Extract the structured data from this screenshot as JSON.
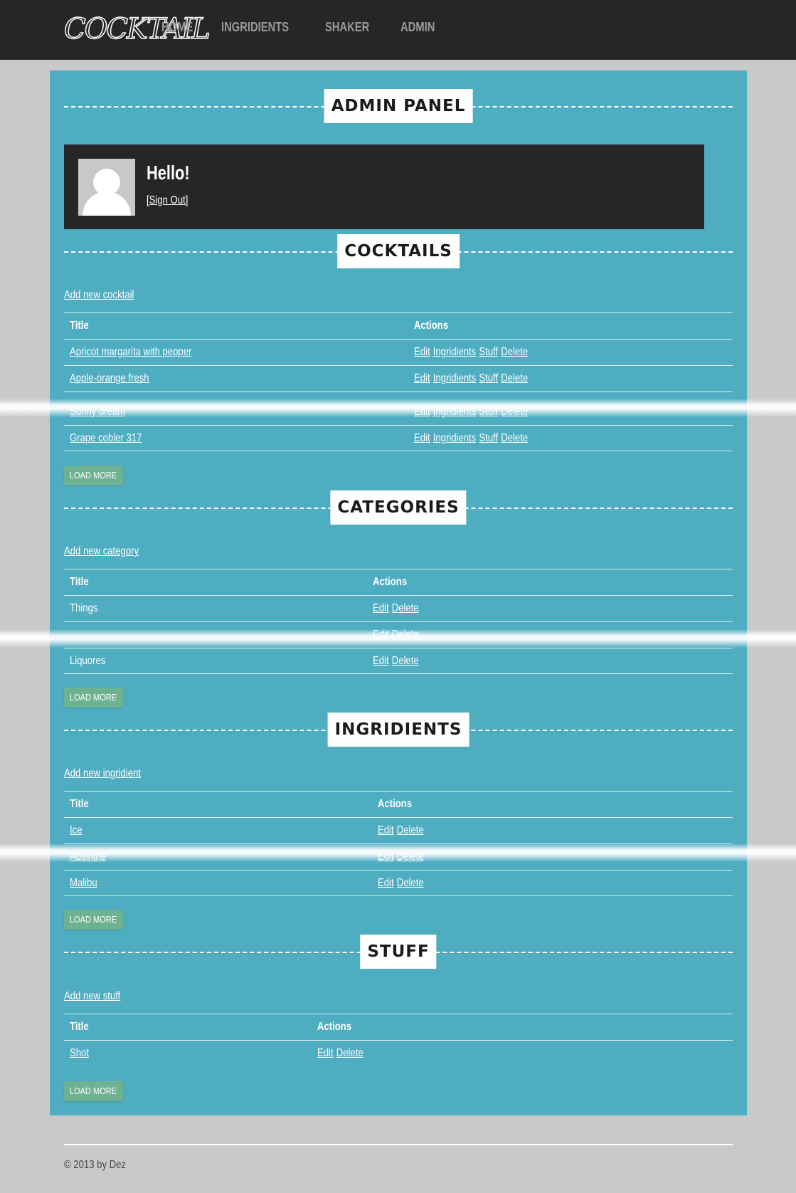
{
  "nav": {
    "brand": "COCKTAIL",
    "links": [
      "HOME",
      "INGRIDIENTS",
      "SHAKER",
      "ADMIN"
    ]
  },
  "admin": {
    "section_title": "ADMIN PANEL",
    "greeting": "Hello!",
    "sign_out": "[Sign Out]"
  },
  "cocktails": {
    "section_title": "COCKTAILS",
    "add_link": "Add new cocktail",
    "headers": {
      "title": "Title",
      "actions": "Actions"
    },
    "rows": [
      {
        "title": "Apricot margarita with pepper",
        "actions": [
          "Edit",
          "Ingridients",
          "Stuff",
          "Delete"
        ]
      },
      {
        "title": "Apple-orange fresh",
        "actions": [
          "Edit",
          "Ingridients",
          "Stuff",
          "Delete"
        ]
      },
      {
        "title": "Sunny dream",
        "actions": [
          "Edit",
          "Ingridients",
          "Stuff",
          "Delete"
        ]
      },
      {
        "title": "Grape cobler 317",
        "actions": [
          "Edit",
          "Ingridients",
          "Stuff",
          "Delete"
        ]
      }
    ],
    "load_more": "LOAD MORE"
  },
  "categories": {
    "section_title": "CATEGORIES",
    "add_link": "Add new category",
    "headers": {
      "title": "Title",
      "actions": "Actions"
    },
    "rows": [
      {
        "title": "Things",
        "actions": [
          "Edit",
          "Delete"
        ]
      },
      {
        "title": "",
        "actions": [
          "Edit",
          "Delete"
        ]
      },
      {
        "title": "Liquores",
        "actions": [
          "Edit",
          "Delete"
        ]
      }
    ],
    "load_more": "LOAD MORE"
  },
  "ingridients": {
    "section_title": "INGRIDIENTS",
    "add_link": "Add new ingridient",
    "headers": {
      "title": "Title",
      "actions": "Actions"
    },
    "rows": [
      {
        "title": "Ice",
        "actions": [
          "Edit",
          "Delete"
        ]
      },
      {
        "title": "Absinthe",
        "actions": [
          "Edit",
          "Delete"
        ]
      },
      {
        "title": "Malibu",
        "actions": [
          "Edit",
          "Delete"
        ]
      }
    ],
    "load_more": "LOAD MORE"
  },
  "stuff": {
    "section_title": "STUFF",
    "add_link": "Add new stuff",
    "headers": {
      "title": "Title",
      "actions": "Actions"
    },
    "rows": [
      {
        "title": "Shot",
        "actions": [
          "Edit",
          "Delete"
        ]
      }
    ],
    "load_more": "LOAD MORE"
  },
  "footer": {
    "text": "© 2013 by Dez"
  },
  "colors": {
    "panel": "#4fadc2",
    "navbar": "#262626",
    "button": "#6db391",
    "background": "#c9c9c9"
  }
}
